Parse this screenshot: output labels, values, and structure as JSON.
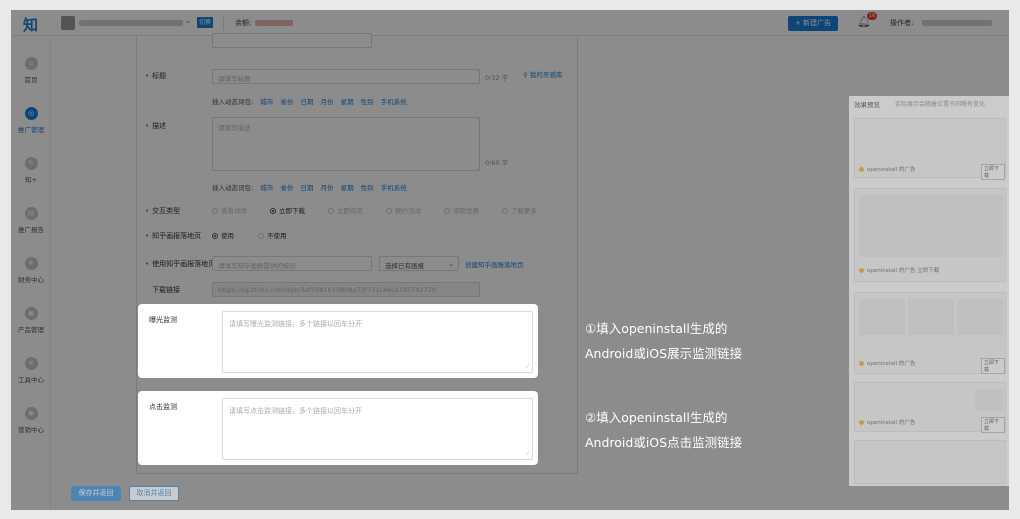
{
  "header": {
    "logo": "知",
    "switch_label": "切换",
    "balance_label": "余额:",
    "new_ad_label": "+ 新建广告",
    "notif_count": "16",
    "operator_label": "操作者:"
  },
  "sidebar": {
    "items": [
      {
        "label": "首页",
        "icon": "home-icon"
      },
      {
        "label": "推广管理",
        "icon": "promotion-icon",
        "active": true
      },
      {
        "label": "知+",
        "icon": "edit-icon"
      },
      {
        "label": "推广报告",
        "icon": "report-icon"
      },
      {
        "label": "财务中心",
        "icon": "yen-icon"
      },
      {
        "label": "产品管理",
        "icon": "product-icon"
      },
      {
        "label": "工具中心",
        "icon": "tool-icon"
      },
      {
        "label": "营销中心",
        "icon": "marketing-icon"
      }
    ]
  },
  "form": {
    "title": {
      "label": "标题",
      "placeholder": "请填写标题",
      "count": "0/32 字",
      "inspiration": "我的灵感库"
    },
    "vars_prefix": "插入动态词包:",
    "vars": [
      "城市",
      "省份",
      "日期",
      "月份",
      "星期",
      "性别",
      "手机系统"
    ],
    "desc": {
      "label": "描述",
      "placeholder": "请填写描述",
      "count": "0/60 字"
    },
    "interaction": {
      "label": "交互类型",
      "options": [
        "查看详情",
        "立即下载",
        "立即购买",
        "预约活动",
        "领取优惠",
        "了解更多"
      ],
      "selected": "立即下载"
    },
    "landing": {
      "label": "知乎画报落地页",
      "options": [
        "使用",
        "不使用"
      ],
      "selected": "使用"
    },
    "landing_pick": {
      "label": "使用知乎画报落地页",
      "placeholder": "请填写知乎画报提供的标识",
      "select": "选择已有画报",
      "create": "创建知乎画报落地页"
    },
    "download": {
      "label": "下载链接",
      "value": "https://sg.zhihu.com/apk/3af5081613809a73f731c4eca725742720"
    }
  },
  "monitor": {
    "exposure_label": "曝光监测",
    "exposure_placeholder": "请填写曝光监测链接，多个链接以回车分开",
    "click_label": "点击监测",
    "click_placeholder": "请填写点击监测链接，多个链接以回车分开"
  },
  "annotations": {
    "note1_line1": "①填入openinstall生成的",
    "note1_line2": "Android或iOS展示监测链接",
    "note2_line1": "②填入openinstall生成的",
    "note2_line2": "Android或iOS点击监测链接"
  },
  "footer": {
    "save_label": "保存并返回",
    "cancel_label": "取消并返回"
  },
  "preview": {
    "title": "效果预览",
    "subtitle": "实际展示会随着位置不同略有变化",
    "ad_source": "openinstall 的广告",
    "btn": "立即下载"
  },
  "colors": {
    "accent": "#1a7fd9",
    "required": "#f04134",
    "overlay": "rgba(0,0,0,0.45)"
  }
}
